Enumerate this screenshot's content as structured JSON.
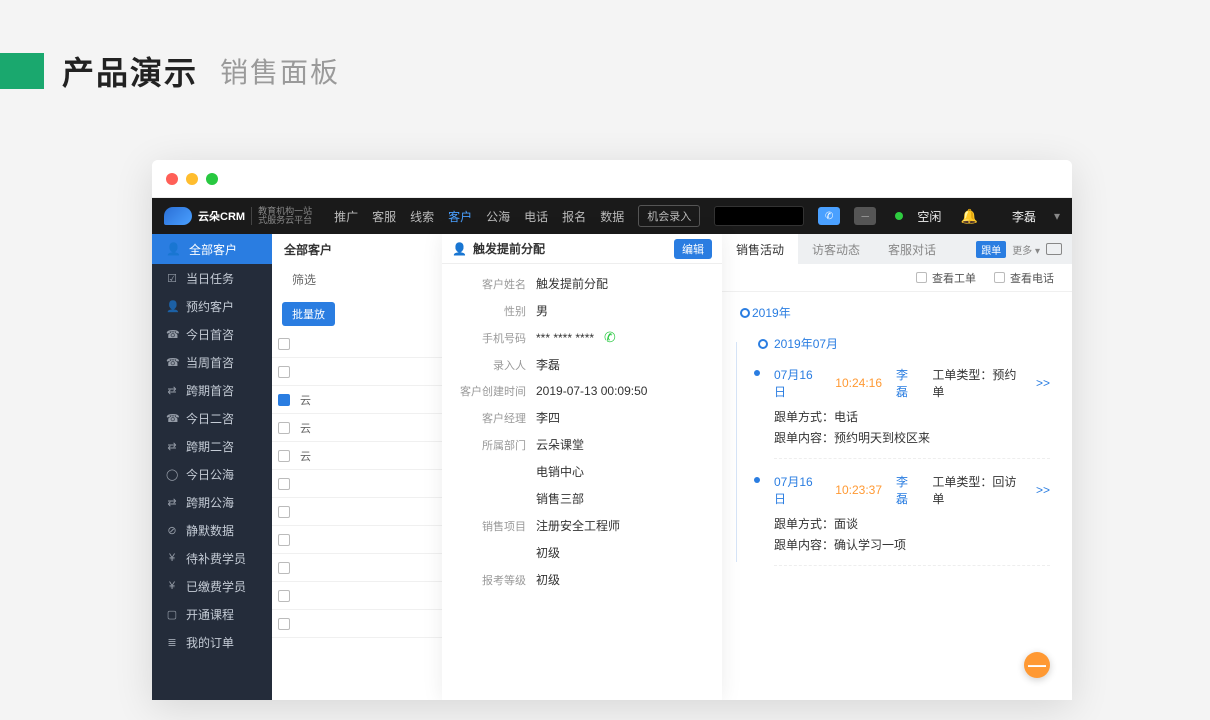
{
  "page": {
    "title": "产品演示",
    "subtitle": "销售面板"
  },
  "topnav": {
    "brand": "云朵CRM",
    "brand_sub1": "教育机构一站",
    "brand_sub2": "式服务云平台",
    "items": [
      "推广",
      "客服",
      "线索",
      "客户",
      "公海",
      "电话",
      "报名",
      "数据"
    ],
    "active_index": 3,
    "opportunity_btn": "机会录入",
    "status": "空闲",
    "user": "李磊"
  },
  "sidebar": {
    "header": "全部客户",
    "items": [
      {
        "icon": "☑",
        "label": "当日任务"
      },
      {
        "icon": "👤",
        "label": "预约客户"
      },
      {
        "icon": "☎",
        "label": "今日首咨"
      },
      {
        "icon": "☎",
        "label": "当周首咨"
      },
      {
        "icon": "⇄",
        "label": "跨期首咨"
      },
      {
        "icon": "☎",
        "label": "今日二咨"
      },
      {
        "icon": "⇄",
        "label": "跨期二咨"
      },
      {
        "icon": "◯",
        "label": "今日公海"
      },
      {
        "icon": "⇄",
        "label": "跨期公海"
      },
      {
        "icon": "⊘",
        "label": "静默数据"
      },
      {
        "icon": "¥",
        "label": "待补费学员"
      },
      {
        "icon": "¥",
        "label": "已缴费学员"
      },
      {
        "icon": "▢",
        "label": "开通课程"
      },
      {
        "icon": "≣",
        "label": "我的订单"
      }
    ]
  },
  "list": {
    "title": "全部客户",
    "filter_label": "筛选",
    "bulk_btn": "批量放",
    "rows": [
      {
        "text": "",
        "sel": false
      },
      {
        "text": "云",
        "sel": true
      },
      {
        "text": "云",
        "sel": false
      },
      {
        "text": "云",
        "sel": false
      },
      {
        "text": "",
        "sel": false
      },
      {
        "text": "",
        "sel": false
      },
      {
        "text": "",
        "sel": false
      },
      {
        "text": "",
        "sel": false
      },
      {
        "text": "",
        "sel": false
      },
      {
        "text": "",
        "sel": false
      }
    ]
  },
  "detail": {
    "title": "触发提前分配",
    "edit_btn": "编辑",
    "fields": [
      {
        "label": "客户姓名",
        "value": "触发提前分配"
      },
      {
        "label": "性别",
        "value": "男"
      },
      {
        "label": "手机号码",
        "value": "*** **** ****",
        "phone": true
      },
      {
        "label": "录入人",
        "value": "李磊"
      },
      {
        "label": "客户创建时间",
        "value": "2019-07-13 00:09:50"
      },
      {
        "label": "客户经理",
        "value": "李四"
      },
      {
        "label": "所属部门",
        "value": "云朵课堂"
      },
      {
        "label": "",
        "value": "电销中心"
      },
      {
        "label": "",
        "value": "销售三部"
      },
      {
        "label": "销售项目",
        "value": "注册安全工程师"
      },
      {
        "label": "",
        "value": "初级"
      },
      {
        "label": "报考等级",
        "value": "初级"
      }
    ]
  },
  "activity": {
    "tabs": [
      "销售活动",
      "访客动态",
      "客服对话"
    ],
    "active_tab": 0,
    "badge": "跟单",
    "more": "更多 ▾",
    "checks": [
      {
        "label": "查看工单"
      },
      {
        "label": "查看电话"
      }
    ],
    "year": "2019年",
    "month": "2019年07月",
    "entries": [
      {
        "date": "07月16日",
        "time": "10:24:16",
        "user": "李磊",
        "type_label": "工单类型：",
        "type": "预约单",
        "method_label": "跟单方式：",
        "method": "电话",
        "content_label": "跟单内容：",
        "content": "预约明天到校区来"
      },
      {
        "date": "07月16日",
        "time": "10:23:37",
        "user": "李磊",
        "type_label": "工单类型：",
        "type": "回访单",
        "method_label": "跟单方式：",
        "method": "面谈",
        "content_label": "跟单内容：",
        "content": "确认学习一项"
      }
    ],
    "expand": ">>"
  },
  "fab": "—"
}
